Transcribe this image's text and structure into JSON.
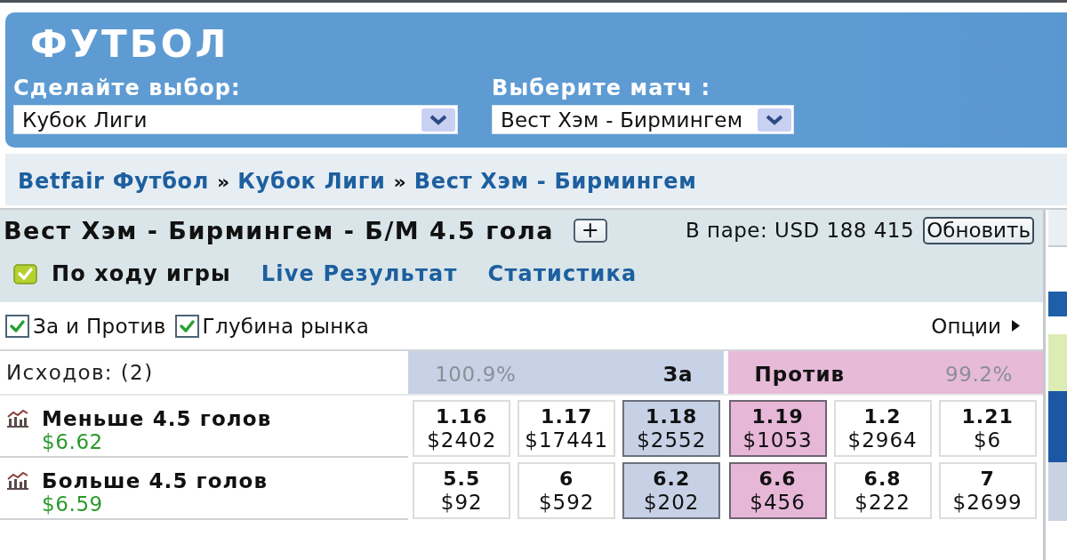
{
  "header": {
    "title": "ФУТБОЛ",
    "selectors": [
      {
        "label": "Сделайте выбор:",
        "value": "Кубок Лиги"
      },
      {
        "label": "Выберите матч :",
        "value": "Вест Хэм - Бирмингем"
      }
    ]
  },
  "breadcrumb": [
    {
      "kind": "link",
      "text": "Betfair Футбол"
    },
    {
      "kind": "separator",
      "text": "»"
    },
    {
      "kind": "link",
      "text": "Кубок Лиги"
    },
    {
      "kind": "separator",
      "text": "»"
    },
    {
      "kind": "link",
      "text": "Вест Хэм - Бирмингем"
    }
  ],
  "market": {
    "title": "Вест Хэм - Бирмингем - Б/М 4.5 гола",
    "expand_button": "+",
    "matched": "В паре: USD 188 415",
    "refresh_button": "Обновить",
    "in_play": {
      "label": "По ходу игры",
      "checked": true
    },
    "links": [
      "Live Результат",
      "Статистика"
    ],
    "view_options": [
      {
        "label": "За и Против",
        "checked": true
      },
      {
        "label": "Глубина рынка",
        "checked": true
      }
    ],
    "options_menu": "Опции"
  },
  "table": {
    "outcomes": "Исходов: (2)",
    "back_header": {
      "percent": "100.9%",
      "label": "За"
    },
    "lay_header": {
      "label": "Против",
      "percent": "99.2%"
    },
    "runners": [
      {
        "name": "Меньше 4.5 голов",
        "profit": "$6.62",
        "cells": [
          {
            "price": "1.16",
            "size": "$2402",
            "kind": "plain"
          },
          {
            "price": "1.17",
            "size": "$17441",
            "kind": "plain"
          },
          {
            "price": "1.18",
            "size": "$2552",
            "kind": "best_back"
          },
          {
            "price": "1.19",
            "size": "$1053",
            "kind": "best_lay"
          },
          {
            "price": "1.2",
            "size": "$2964",
            "kind": "plain"
          },
          {
            "price": "1.21",
            "size": "$6",
            "kind": "plain"
          }
        ]
      },
      {
        "name": "Больше 4.5 голов",
        "profit": "$6.59",
        "cells": [
          {
            "price": "5.5",
            "size": "$92",
            "kind": "plain"
          },
          {
            "price": "6",
            "size": "$592",
            "kind": "plain"
          },
          {
            "price": "6.2",
            "size": "$202",
            "kind": "best_back"
          },
          {
            "price": "6.6",
            "size": "$456",
            "kind": "best_lay"
          },
          {
            "price": "6.8",
            "size": "$222",
            "kind": "plain"
          },
          {
            "price": "7",
            "size": "$2699",
            "kind": "plain"
          }
        ]
      }
    ]
  }
}
